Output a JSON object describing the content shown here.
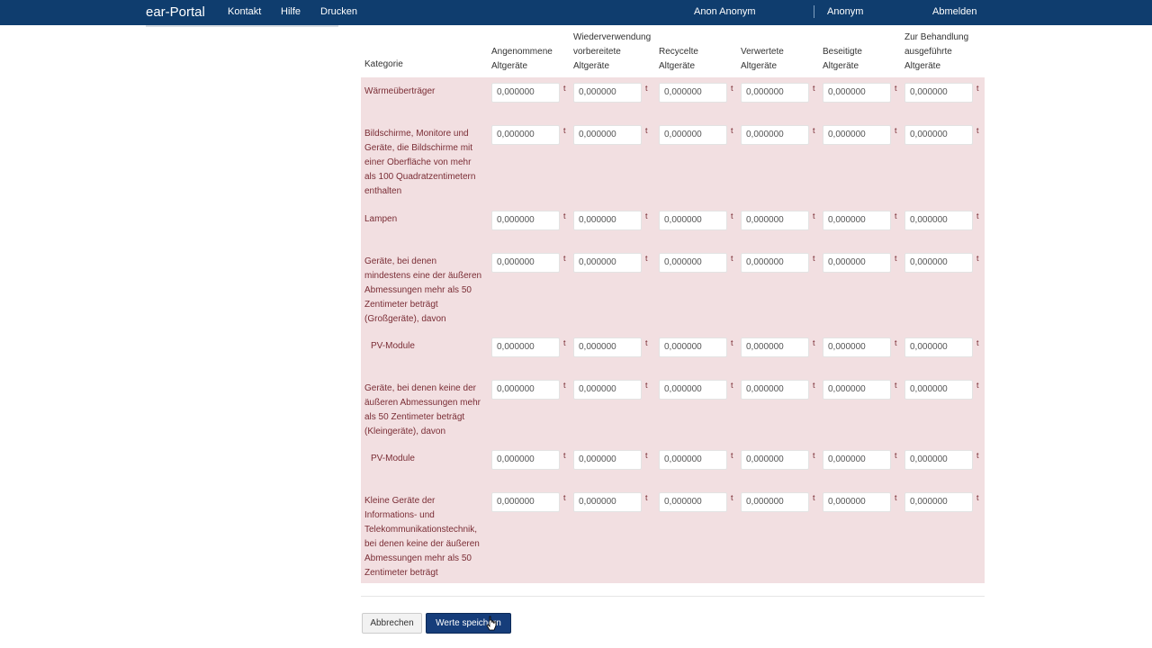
{
  "header": {
    "brand": "ear-Portal",
    "nav": [
      "Kontakt",
      "Hilfe",
      "Drucken"
    ],
    "user_name": "Anon Anonym",
    "account": "Anonym",
    "logout": "Abmelden"
  },
  "table": {
    "category_header": "Kategorie",
    "column_headers": [
      [
        "Angenommene",
        "Altgeräte"
      ],
      [
        "Wiederverwendung",
        "vorbereitete",
        "Altgeräte"
      ],
      [
        "Recycelte",
        "Altgeräte"
      ],
      [
        "Verwertete",
        "Altgeräte"
      ],
      [
        "Beseitigte",
        "Altgeräte"
      ],
      [
        "Zur Behandlung",
        "ausgeführte",
        "Altgeräte"
      ]
    ],
    "unit": "t",
    "rows": [
      {
        "label": [
          "Wärmeüberträger"
        ],
        "values": [
          "0,000000",
          "0,000000",
          "0,000000",
          "0,000000",
          "0,000000",
          "0,000000"
        ]
      },
      {
        "label": [
          "Bildschirme, Monitore und",
          "Geräte, die Bildschirme mit",
          "einer Oberfläche von mehr",
          "als 100 Quadratzentimetern",
          "enthalten"
        ],
        "values": [
          "0,000000",
          "0,000000",
          "0,000000",
          "0,000000",
          "0,000000",
          "0,000000"
        ]
      },
      {
        "label": [
          "Lampen"
        ],
        "values": [
          "0,000000",
          "0,000000",
          "0,000000",
          "0,000000",
          "0,000000",
          "0,000000"
        ]
      },
      {
        "label": [
          "Geräte, bei denen",
          "mindestens eine der äußeren",
          "Abmessungen mehr als 50",
          "Zentimeter beträgt",
          "(Großgeräte), davon"
        ],
        "values": [
          "0,000000",
          "0,000000",
          "0,000000",
          "0,000000",
          "0,000000",
          "0,000000"
        ]
      },
      {
        "label": [
          "PV-Module"
        ],
        "values": [
          "0,000000",
          "0,000000",
          "0,000000",
          "0,000000",
          "0,000000",
          "0,000000"
        ],
        "sub": true
      },
      {
        "label": [
          "Geräte, bei denen keine der",
          "äußeren Abmessungen mehr",
          "als 50 Zentimeter beträgt",
          "(Kleingeräte), davon"
        ],
        "values": [
          "0,000000",
          "0,000000",
          "0,000000",
          "0,000000",
          "0,000000",
          "0,000000"
        ]
      },
      {
        "label": [
          "PV-Module"
        ],
        "values": [
          "0,000000",
          "0,000000",
          "0,000000",
          "0,000000",
          "0,000000",
          "0,000000"
        ],
        "sub": true
      },
      {
        "label": [
          "Kleine Geräte der",
          "Informations- und",
          "Telekommunikationstechnik,",
          "bei denen keine der äußeren",
          "Abmessungen mehr als 50",
          "Zentimeter beträgt"
        ],
        "values": [
          "0,000000",
          "0,000000",
          "0,000000",
          "0,000000",
          "0,000000",
          "0,000000"
        ]
      }
    ]
  },
  "actions": {
    "cancel": "Abbrechen",
    "save": "Werte speichern"
  }
}
